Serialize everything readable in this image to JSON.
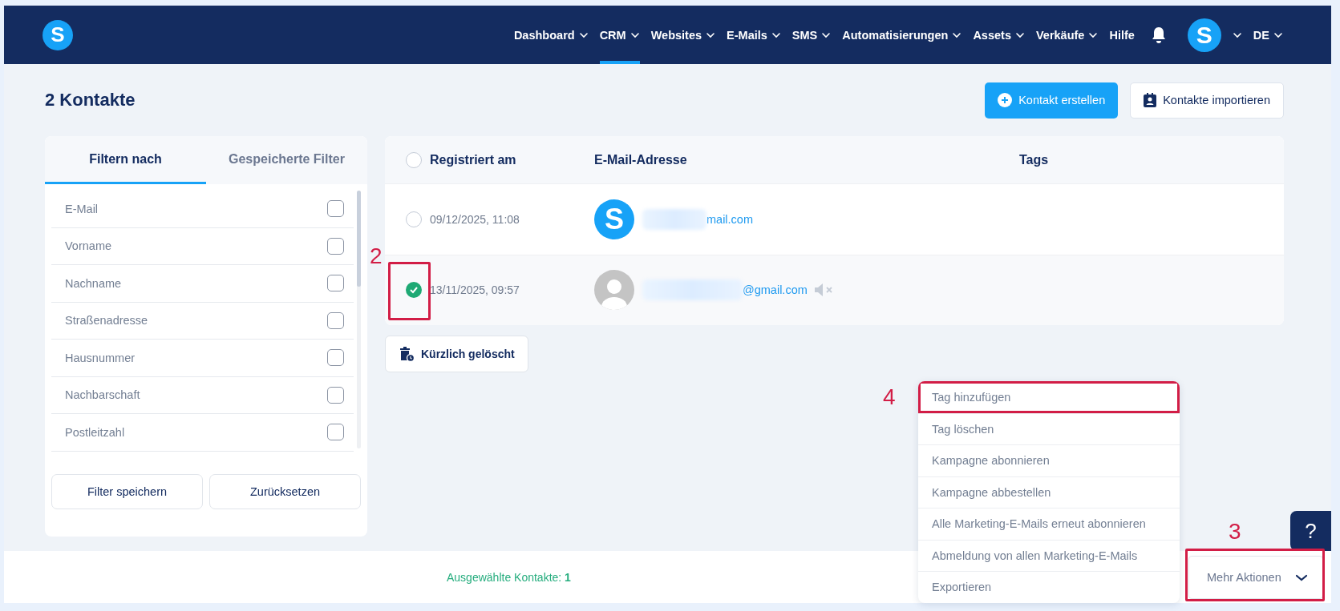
{
  "nav": {
    "logo": "S",
    "items": [
      {
        "label": "Dashboard",
        "dropdown": true,
        "selected": false
      },
      {
        "label": "CRM",
        "dropdown": true,
        "selected": true
      },
      {
        "label": "Websites",
        "dropdown": true,
        "selected": false
      },
      {
        "label": "E-Mails",
        "dropdown": true,
        "selected": false
      },
      {
        "label": "SMS",
        "dropdown": true,
        "selected": false
      },
      {
        "label": "Automatisierungen",
        "dropdown": true,
        "selected": false
      },
      {
        "label": "Assets",
        "dropdown": true,
        "selected": false
      },
      {
        "label": "Verkäufe",
        "dropdown": true,
        "selected": false
      },
      {
        "label": "Hilfe",
        "dropdown": false,
        "selected": false
      }
    ],
    "avatar": "S",
    "language": "DE"
  },
  "page_title": "2 Kontakte",
  "header_buttons": [
    {
      "label": "Kontakt erstellen",
      "kind": "primary"
    },
    {
      "label": "Kontakte importieren",
      "kind": "secondary"
    }
  ],
  "filter_panel": {
    "tabs": [
      {
        "label": "Filtern nach",
        "selected": true
      },
      {
        "label": "Gespeicherte Filter",
        "selected": false
      }
    ],
    "fields": [
      {
        "label": "E-Mail",
        "checked": false
      },
      {
        "label": "Vorname",
        "checked": false
      },
      {
        "label": "Nachname",
        "checked": false
      },
      {
        "label": "Straßenadresse",
        "checked": false
      },
      {
        "label": "Hausnummer",
        "checked": false
      },
      {
        "label": "Nachbarschaft",
        "checked": false
      },
      {
        "label": "Postleitzahl",
        "checked": false
      }
    ],
    "buttons": [
      "Filter speichern",
      "Zurücksetzen"
    ]
  },
  "table": {
    "select_all": {
      "checked": false
    },
    "columns": [
      "Registriert am",
      "E-Mail-Adresse",
      "Tags"
    ],
    "rows": [
      {
        "registered": "09/12/2025, 11:08",
        "email": "mail.com",
        "avatar": {
          "kind": "letter",
          "letter": "S"
        },
        "selected": false,
        "muted": false
      },
      {
        "registered": "13/11/2025, 09:57",
        "email": "@gmail.com",
        "avatar": {
          "kind": "silhouette"
        },
        "selected": true,
        "muted": true
      }
    ]
  },
  "deleted_button": "Kürzlich gelöscht",
  "footer": {
    "selected_label": "Ausgewählte Kontakte:",
    "selected_count": "1",
    "more_actions": {
      "label": "Mehr Aktionen",
      "expanded": true
    }
  },
  "menu": [
    {
      "label": "Tag hinzufügen",
      "highlighted": true
    },
    {
      "label": "Tag löschen",
      "highlighted": false
    },
    {
      "label": "Kampagne abonnieren",
      "highlighted": false
    },
    {
      "label": "Kampagne abbestellen",
      "highlighted": false
    },
    {
      "label": "Alle Marketing-E-Mails erneut abonnieren",
      "highlighted": false
    },
    {
      "label": "Abmeldung von allen Marketing-E-Mails",
      "highlighted": false
    },
    {
      "label": "Exportieren",
      "highlighted": false
    }
  ],
  "help_button": "?",
  "annotations": [
    {
      "label": "2",
      "kind": "box"
    },
    {
      "label": "4",
      "kind": "number"
    },
    {
      "label": "3",
      "kind": "box"
    }
  ]
}
